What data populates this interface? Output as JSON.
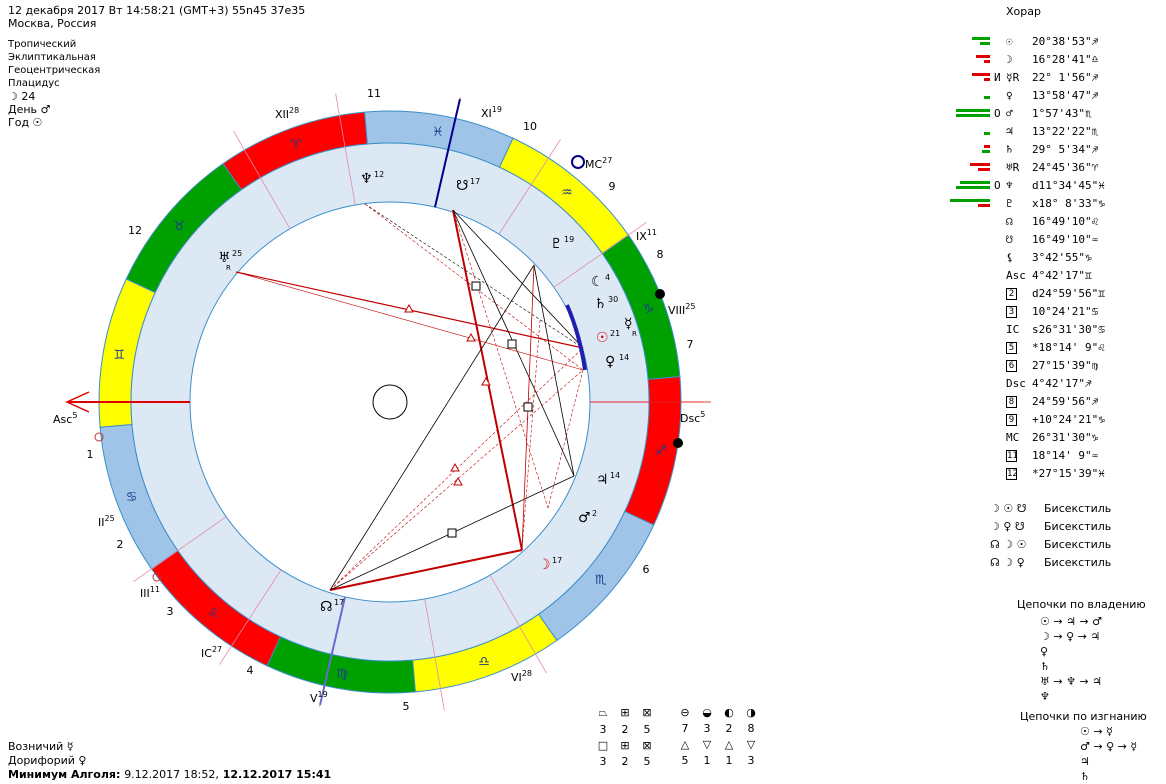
{
  "header": {
    "datetime_line": "12 декабря 2017  Вт  14:58:21 (GMT+3) 55n45  37e35",
    "place_line": "Москва, Россия"
  },
  "params": {
    "zodiac": "Тропический",
    "coords": "Эклиптикальная",
    "center": "Геоцентрическая",
    "houses": "Плацидус",
    "moon_day": "☽  24",
    "day_ruler": "День ♂",
    "year_ruler": "Год ☉"
  },
  "wheel": {
    "house_numbers": [
      "1",
      "2",
      "3",
      "4",
      "5",
      "6",
      "7",
      "8",
      "9",
      "10",
      "11",
      "12"
    ],
    "cusp_labels": {
      "asc": "Asc",
      "asc_deg": "5",
      "ii": "II",
      "ii_deg": "25",
      "iii": "III",
      "iii_deg": "11",
      "ic": "IC",
      "ic_deg": "27",
      "v": "V",
      "v_deg": "19",
      "vi": "VI",
      "vi_deg": "28",
      "dsc": "Dsc",
      "dsc_deg": "5",
      "viii": "VIII",
      "viii_deg": "25",
      "ix": "IX",
      "ix_deg": "11",
      "mc": "MC",
      "mc_deg": "27",
      "xi": "XI",
      "xi_deg": "19",
      "xii": "XII",
      "xii_deg": "28"
    },
    "sign_glyphs": [
      "♊",
      "♉",
      "♈",
      "♓",
      "♒",
      "♑",
      "♐",
      "♏",
      "♎",
      "♍",
      "♌",
      "♋"
    ],
    "sign_colors": {
      "air": "#ffff00",
      "earth": "#00a000",
      "fire": "#ff0000",
      "water": "#a0c4e8"
    },
    "planets": [
      {
        "glyph": "♆",
        "deg": "12",
        "name": "neptune"
      },
      {
        "glyph": "☋",
        "deg": "17",
        "name": "south-node"
      },
      {
        "glyph": "♅",
        "deg": "25",
        "name": "uranus",
        "retro": "R"
      },
      {
        "glyph": "♇",
        "deg": "19",
        "name": "pluto"
      },
      {
        "glyph": "☾",
        "deg": "4",
        "name": "lilith"
      },
      {
        "glyph": "♄",
        "deg": "30",
        "name": "saturn"
      },
      {
        "glyph": "☿",
        "deg": "",
        "name": "mercury",
        "retro": "R"
      },
      {
        "glyph": "☉",
        "deg": "21",
        "name": "sun"
      },
      {
        "glyph": "♀",
        "deg": "14",
        "name": "venus"
      },
      {
        "glyph": "♃",
        "deg": "14",
        "name": "jupiter"
      },
      {
        "glyph": "♂",
        "deg": "2",
        "name": "mars"
      },
      {
        "glyph": "☽",
        "deg": "17",
        "name": "moon"
      },
      {
        "glyph": "☊",
        "deg": "17",
        "name": "north-node"
      }
    ]
  },
  "panel": {
    "title": "Хорар",
    "rows": [
      {
        "flag": "",
        "sym": "☉",
        "pos": "20°38'53\"♐"
      },
      {
        "flag": "",
        "sym": "☽",
        "pos": "16°28'41\"♎"
      },
      {
        "flag": "И",
        "sym": "☿R",
        "pos": "22° 1'56\"♐"
      },
      {
        "flag": "",
        "sym": "♀",
        "pos": "13°58'47\"♐"
      },
      {
        "flag": "О",
        "sym": "♂",
        "pos": " 1°57'43\"♏"
      },
      {
        "flag": "",
        "sym": "♃",
        "pos": "13°22'22\"♏"
      },
      {
        "flag": "",
        "sym": "♄",
        "pos": "29° 5'34\"♐"
      },
      {
        "flag": "",
        "sym": "♅R",
        "pos": "24°45'36\"♈"
      },
      {
        "flag": "О",
        "sym": "♆",
        "pos": "d11°34'45\"♓"
      },
      {
        "flag": "",
        "sym": "♇",
        "pos": "x18° 8'33\"♑"
      },
      {
        "flag": "",
        "sym": "☊",
        "pos": "16°49'10\"♌"
      },
      {
        "flag": "",
        "sym": "☋",
        "pos": "16°49'10\"♒"
      },
      {
        "flag": "",
        "sym": "⚸",
        "pos": " 3°42'55\"♑"
      },
      {
        "flag": "",
        "sym": "Asc",
        "pos": " 4°42'17\"♊"
      },
      {
        "flag": "",
        "sym": "2",
        "pos": "d24°59'56\"♊",
        "box": true
      },
      {
        "flag": "",
        "sym": "3",
        "pos": "10°24'21\"♋",
        "box": true
      },
      {
        "flag": "",
        "sym": "IC",
        "pos": "s26°31'30\"♋"
      },
      {
        "flag": "",
        "sym": "5",
        "pos": "*18°14' 9\"♌",
        "box": true
      },
      {
        "flag": "",
        "sym": "6",
        "pos": "27°15'39\"♍",
        "box": true
      },
      {
        "flag": "",
        "sym": "Dsc",
        "pos": " 4°42'17\"♐"
      },
      {
        "flag": "",
        "sym": "8",
        "pos": "24°59'56\"♐",
        "box": true
      },
      {
        "flag": "",
        "sym": "9",
        "pos": "+10°24'21\"♑",
        "box": true
      },
      {
        "flag": "",
        "sym": "MC",
        "pos": "26°31'30\"♑"
      },
      {
        "flag": "",
        "sym": "11",
        "pos": "18°14' 9\"♒",
        "box": true
      },
      {
        "flag": "",
        "sym": "12",
        "pos": "*27°15'39\"♓",
        "box": true
      }
    ]
  },
  "aspects": [
    {
      "glyphs": "☽ ☉ ☋",
      "label": "Бисекстиль"
    },
    {
      "glyphs": "☽ ♀ ☋",
      "label": "Бисекстиль"
    },
    {
      "glyphs": "☊ ☽ ☉",
      "label": "Бисекстиль"
    },
    {
      "glyphs": "☊ ☽ ♀",
      "label": "Бисекстиль"
    }
  ],
  "chains1": {
    "title": "Цепочки по владению",
    "lines": [
      "☉ → ♃ → ♂",
      "☽ → ♀ → ♃",
      "♀",
      "♄",
      "♅ → ♆ → ♃",
      "♆"
    ]
  },
  "chains2": {
    "title": "Цепочки по изгнанию",
    "lines": [
      "☉ → ☿",
      "♂ → ♀ → ☿",
      "♃",
      "♄"
    ]
  },
  "bottom": {
    "vozn_label": "Возничий",
    "vozn_val": "☿",
    "dorif_label": "Дорифорий",
    "dorif_val": "♀",
    "algol_label": "Минимум Алголя:",
    "algol_val1": "9.12.2017 18:52,",
    "algol_val2": "12.12.2017 15:41"
  },
  "stats": {
    "row1": [
      "3",
      "2",
      "5"
    ],
    "row2": [
      "3",
      "2",
      "5"
    ],
    "row3": [
      "7",
      "3",
      "2",
      "8"
    ],
    "row4": [
      "5",
      "1",
      "1",
      "3"
    ]
  }
}
